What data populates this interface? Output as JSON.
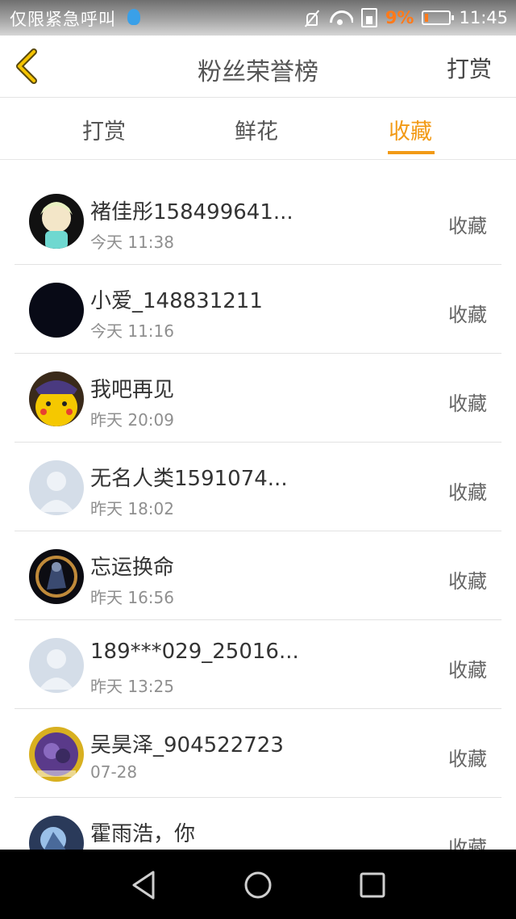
{
  "status_bar": {
    "carrier": "仅限紧急呼叫",
    "battery": "9%",
    "time": "11:45"
  },
  "header": {
    "title": "粉丝荣誉榜",
    "right_action": "打赏"
  },
  "tabs": [
    {
      "label": "打赏",
      "active": false
    },
    {
      "label": "鲜花",
      "active": false
    },
    {
      "label": "收藏",
      "active": true
    }
  ],
  "accent_color": "#f29a16",
  "fans": [
    {
      "name": "褚佳彤158499641...",
      "time": "今天 11:38",
      "action": "收藏"
    },
    {
      "name": "小爱_148831211",
      "time": "今天 11:16",
      "action": "收藏"
    },
    {
      "name": "我吧再见",
      "time": "昨天 20:09",
      "action": "收藏"
    },
    {
      "name": "无名人类1591074...",
      "time": "昨天 18:02",
      "action": "收藏"
    },
    {
      "name": "忘运换命",
      "time": "昨天 16:56",
      "action": "收藏"
    },
    {
      "name": "189***029_25016...",
      "time": "昨天 13:25",
      "action": "收藏"
    },
    {
      "name": "吴昊泽_904522723",
      "time": "07-28",
      "action": "收藏"
    },
    {
      "name": "霍雨浩，你",
      "time": "",
      "action": "收藏"
    }
  ]
}
